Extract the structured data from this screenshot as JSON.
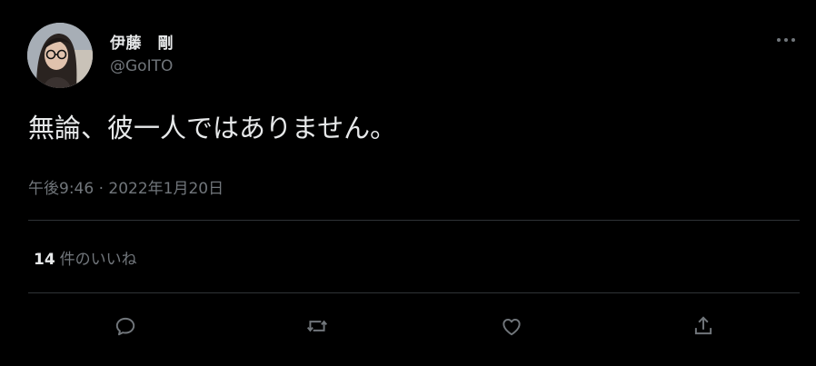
{
  "tweet": {
    "author_name": "伊藤　剛",
    "author_handle": "@GoITO",
    "text": "無論、彼一人ではありません。",
    "timestamp": "午後9:46 · 2022年1月20日",
    "likes_count": "14",
    "likes_label": "件のいいね"
  },
  "actions": {
    "reply": "reply-icon",
    "retweet": "retweet-icon",
    "like": "heart-icon",
    "share": "share-icon"
  },
  "colors": {
    "background": "#000000",
    "text_primary": "#e7e9ea",
    "text_secondary": "#71767b",
    "divider": "#2f3336"
  }
}
